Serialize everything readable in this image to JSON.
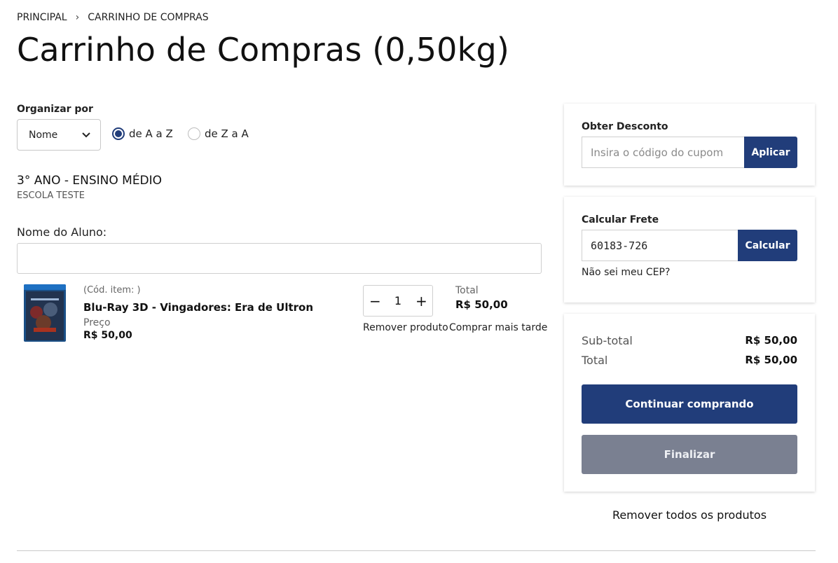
{
  "breadcrumb": {
    "home": "PRINCIPAL",
    "current": "CARRINHO DE COMPRAS"
  },
  "page_title": "Carrinho de Compras (0,50kg)",
  "sort": {
    "label": "Organizar por",
    "selected": "Nome",
    "order_az": "de A a Z",
    "order_za": "de Z a A",
    "order_selected": "az"
  },
  "group": {
    "title": "3° ANO - ENSINO MÉDIO",
    "school": "ESCOLA TESTE"
  },
  "student": {
    "label": "Nome do Aluno:",
    "value": ""
  },
  "item": {
    "code": "(Cód. item: )",
    "name": "Blu-Ray 3D - Vingadores: Era de Ultron",
    "price_label": "Preço",
    "price": "R$ 50,00",
    "quantity": "1",
    "minus": "−",
    "plus": "+",
    "total_label": "Total",
    "total": "R$ 50,00",
    "remove": "Remover produto",
    "buy_later": "Comprar mais tarde"
  },
  "discount": {
    "label": "Obter Desconto",
    "placeholder": "Insira o código do cupom",
    "button": "Aplicar"
  },
  "shipping": {
    "label": "Calcular Frete",
    "value": "60183-726",
    "button": "Calcular",
    "cep_link": "Não sei meu CEP?"
  },
  "summary": {
    "subtotal_label": "Sub-total",
    "subtotal": "R$ 50,00",
    "total_label": "Total",
    "total": "R$ 50,00",
    "continue": "Continuar comprando",
    "finish": "Finalizar"
  },
  "remove_all": "Remover todos os produtos",
  "colors": {
    "primary": "#213d7a",
    "disabled": "#7a8091"
  }
}
